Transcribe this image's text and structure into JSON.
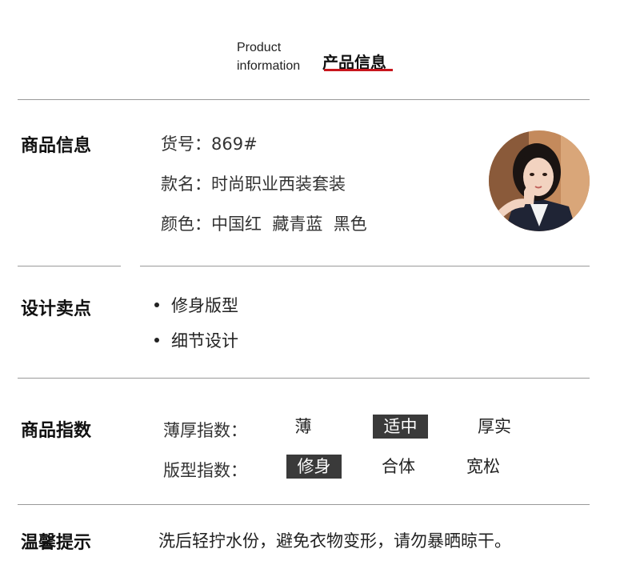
{
  "header": {
    "title_en_line1": "Product",
    "title_en_line2": "information",
    "title_cn": "产品信息"
  },
  "product_info": {
    "title": "商品信息",
    "sku": "货号：869#",
    "style_name": "款名：时尚职业西装套装",
    "colors": "颜色：中国红  藏青蓝  黑色"
  },
  "design_points": {
    "title": "设计卖点",
    "items": [
      "修身版型",
      "细节设计"
    ]
  },
  "product_index": {
    "title": "商品指数",
    "thickness_label": "薄厚指数：",
    "thickness_options": [
      "薄",
      "适中",
      "厚实"
    ],
    "thickness_selected": "适中",
    "fit_label": "版型指数：",
    "fit_options": [
      "修身",
      "合体",
      "宽松"
    ],
    "fit_selected": "修身"
  },
  "care_tips": {
    "title": "温馨提示",
    "text": "洗后轻拧水份，避免衣物变形，请勿暴晒晾干。"
  },
  "colors": {
    "accent": "#c8161d",
    "selected_bg": "#3a3a3a",
    "divider": "#999999"
  }
}
